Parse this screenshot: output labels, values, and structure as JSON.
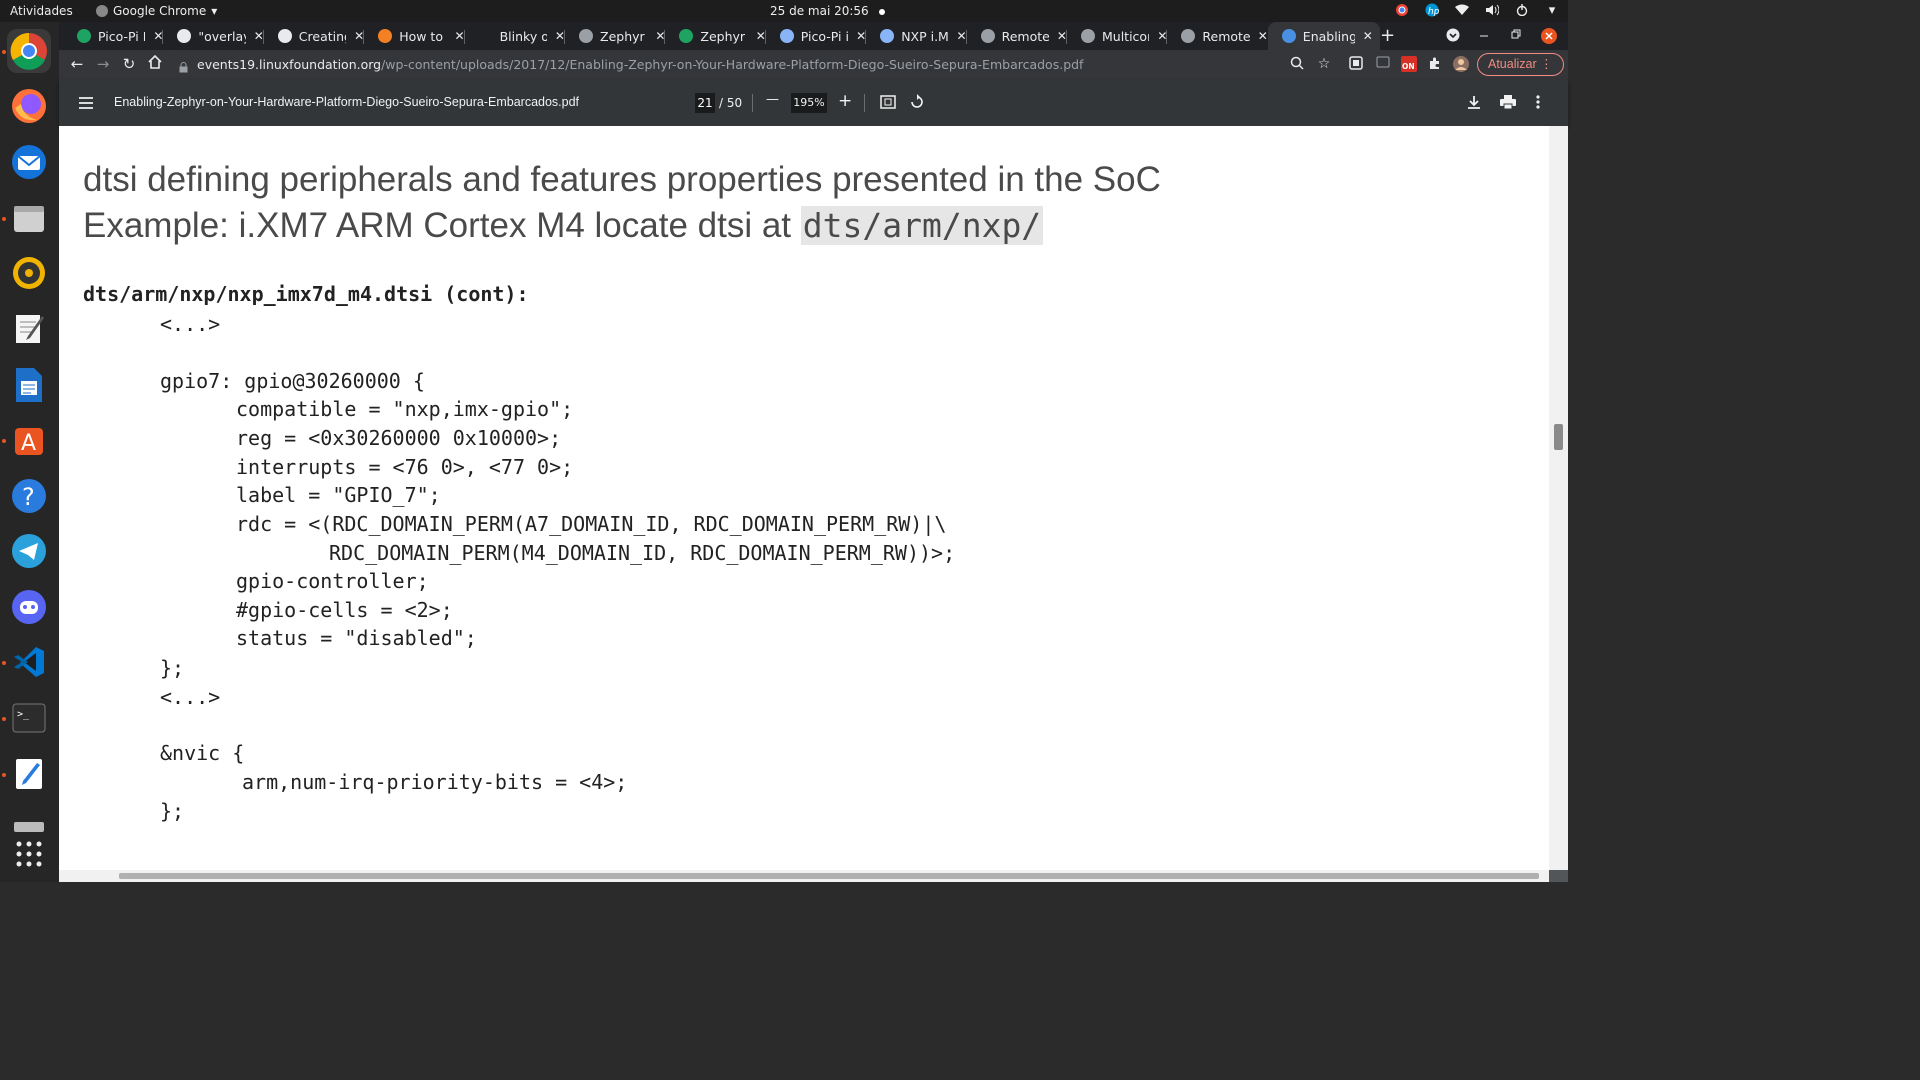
{
  "topbar": {
    "activities": "Atividades",
    "app_name": "Google Chrome",
    "app_menu_arrow": "▾",
    "clock": "25 de mai  20:56"
  },
  "dock": {
    "apps": [
      "chrome-icon",
      "firefox-icon",
      "thunderbird-icon",
      "files-icon",
      "rhythmbox-icon",
      "text-editor-icon",
      "writer-icon",
      "software-center-icon",
      "help-icon",
      "telegram-icon",
      "discord-icon",
      "vscode-icon",
      "terminal-icon",
      "notes-icon",
      "drive-icon",
      "app-grid-icon"
    ]
  },
  "browser": {
    "tabs": [
      {
        "label": "Pico-Pi II",
        "color": "#1ea362"
      },
      {
        "label": "\"overlay",
        "color": "#e8eaed"
      },
      {
        "label": "Creating",
        "color": "#e8eaed"
      },
      {
        "label": "How to s",
        "color": "#f48024"
      },
      {
        "label": "Blinky or",
        "color": "#202124"
      },
      {
        "label": "Zephyr B",
        "color": "#9aa0a6"
      },
      {
        "label": "Zephyr A",
        "color": "#1ea362"
      },
      {
        "label": "Pico-Pi i.",
        "color": "#8ab4f8"
      },
      {
        "label": "NXP i.MX",
        "color": "#8ab4f8"
      },
      {
        "label": "Remote",
        "color": "#9aa0a6"
      },
      {
        "label": "Multicor",
        "color": "#9aa0a6"
      },
      {
        "label": "Remote",
        "color": "#9aa0a6"
      },
      {
        "label": "Enabling",
        "color": "#4a90e2"
      }
    ],
    "tab_close": "✕",
    "new_tab": "+",
    "url_host": "events19.linuxfoundation.org",
    "url_path": "/wp-content/uploads/2017/12/Enabling-Zephyr-on-Your-Hardware-Platform-Diego-Sueiro-Sepura-Embarcados.pdf",
    "update_button": "Atualizar  ⋮",
    "extension_badge": "ON"
  },
  "pdf": {
    "filename": "Enabling-Zephyr-on-Your-Hardware-Platform-Diego-Sueiro-Sepura-Embarcados.pdf",
    "current_page": "21",
    "page_total": "/  50",
    "zoom": "195%",
    "zoom_out": "—",
    "zoom_in": "+"
  },
  "slide": {
    "heading_line1": "dtsi defining peripherals and features properties presented in the SoC",
    "heading_line2_text": "Example: i.XM7 ARM Cortex M4 locate dtsi at ",
    "heading_line2_path": "dts/arm/nxp/",
    "file_title": "dts/arm/nxp/nxp_imx7d_m4.dtsi (cont):",
    "code_lines": [
      "<...>",
      "gpio7: gpio@30260000 {",
      "compatible = \"nxp,imx-gpio\";",
      "reg = <0x30260000 0x10000>;",
      "interrupts = <76 0>, <77 0>;",
      "label = \"GPIO_7\";",
      "rdc = <(RDC_DOMAIN_PERM(A7_DOMAIN_ID, RDC_DOMAIN_PERM_RW)|\\",
      "RDC_DOMAIN_PERM(M4_DOMAIN_ID, RDC_DOMAIN_PERM_RW))>;",
      "gpio-controller;",
      "#gpio-cells = <2>;",
      "status = \"disabled\";",
      "};",
      "<...>",
      "&nvic {",
      "arm,num-irq-priority-bits = <4>;",
      "};"
    ]
  }
}
